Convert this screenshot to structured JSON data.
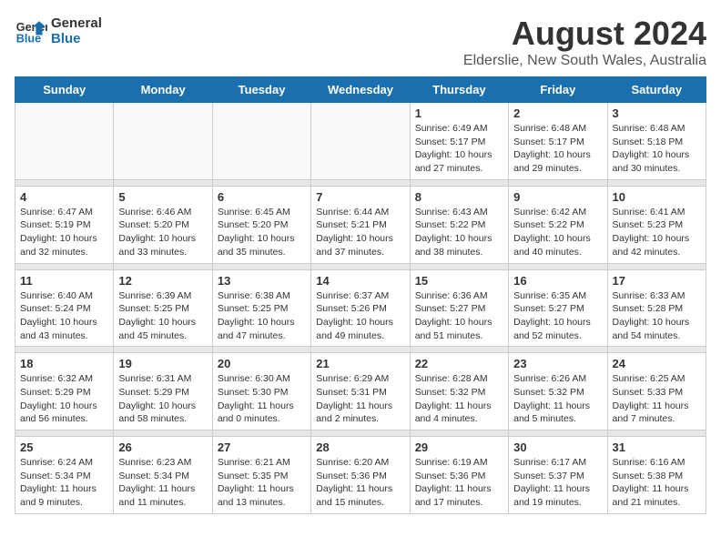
{
  "header": {
    "logo_line1": "General",
    "logo_line2": "Blue",
    "month": "August 2024",
    "location": "Elderslie, New South Wales, Australia"
  },
  "weekdays": [
    "Sunday",
    "Monday",
    "Tuesday",
    "Wednesday",
    "Thursday",
    "Friday",
    "Saturday"
  ],
  "weeks": [
    [
      {
        "day": "",
        "info": ""
      },
      {
        "day": "",
        "info": ""
      },
      {
        "day": "",
        "info": ""
      },
      {
        "day": "",
        "info": ""
      },
      {
        "day": "1",
        "info": "Sunrise: 6:49 AM\nSunset: 5:17 PM\nDaylight: 10 hours and 27 minutes."
      },
      {
        "day": "2",
        "info": "Sunrise: 6:48 AM\nSunset: 5:17 PM\nDaylight: 10 hours and 29 minutes."
      },
      {
        "day": "3",
        "info": "Sunrise: 6:48 AM\nSunset: 5:18 PM\nDaylight: 10 hours and 30 minutes."
      }
    ],
    [
      {
        "day": "4",
        "info": "Sunrise: 6:47 AM\nSunset: 5:19 PM\nDaylight: 10 hours and 32 minutes."
      },
      {
        "day": "5",
        "info": "Sunrise: 6:46 AM\nSunset: 5:20 PM\nDaylight: 10 hours and 33 minutes."
      },
      {
        "day": "6",
        "info": "Sunrise: 6:45 AM\nSunset: 5:20 PM\nDaylight: 10 hours and 35 minutes."
      },
      {
        "day": "7",
        "info": "Sunrise: 6:44 AM\nSunset: 5:21 PM\nDaylight: 10 hours and 37 minutes."
      },
      {
        "day": "8",
        "info": "Sunrise: 6:43 AM\nSunset: 5:22 PM\nDaylight: 10 hours and 38 minutes."
      },
      {
        "day": "9",
        "info": "Sunrise: 6:42 AM\nSunset: 5:22 PM\nDaylight: 10 hours and 40 minutes."
      },
      {
        "day": "10",
        "info": "Sunrise: 6:41 AM\nSunset: 5:23 PM\nDaylight: 10 hours and 42 minutes."
      }
    ],
    [
      {
        "day": "11",
        "info": "Sunrise: 6:40 AM\nSunset: 5:24 PM\nDaylight: 10 hours and 43 minutes."
      },
      {
        "day": "12",
        "info": "Sunrise: 6:39 AM\nSunset: 5:25 PM\nDaylight: 10 hours and 45 minutes."
      },
      {
        "day": "13",
        "info": "Sunrise: 6:38 AM\nSunset: 5:25 PM\nDaylight: 10 hours and 47 minutes."
      },
      {
        "day": "14",
        "info": "Sunrise: 6:37 AM\nSunset: 5:26 PM\nDaylight: 10 hours and 49 minutes."
      },
      {
        "day": "15",
        "info": "Sunrise: 6:36 AM\nSunset: 5:27 PM\nDaylight: 10 hours and 51 minutes."
      },
      {
        "day": "16",
        "info": "Sunrise: 6:35 AM\nSunset: 5:27 PM\nDaylight: 10 hours and 52 minutes."
      },
      {
        "day": "17",
        "info": "Sunrise: 6:33 AM\nSunset: 5:28 PM\nDaylight: 10 hours and 54 minutes."
      }
    ],
    [
      {
        "day": "18",
        "info": "Sunrise: 6:32 AM\nSunset: 5:29 PM\nDaylight: 10 hours and 56 minutes."
      },
      {
        "day": "19",
        "info": "Sunrise: 6:31 AM\nSunset: 5:29 PM\nDaylight: 10 hours and 58 minutes."
      },
      {
        "day": "20",
        "info": "Sunrise: 6:30 AM\nSunset: 5:30 PM\nDaylight: 11 hours and 0 minutes."
      },
      {
        "day": "21",
        "info": "Sunrise: 6:29 AM\nSunset: 5:31 PM\nDaylight: 11 hours and 2 minutes."
      },
      {
        "day": "22",
        "info": "Sunrise: 6:28 AM\nSunset: 5:32 PM\nDaylight: 11 hours and 4 minutes."
      },
      {
        "day": "23",
        "info": "Sunrise: 6:26 AM\nSunset: 5:32 PM\nDaylight: 11 hours and 5 minutes."
      },
      {
        "day": "24",
        "info": "Sunrise: 6:25 AM\nSunset: 5:33 PM\nDaylight: 11 hours and 7 minutes."
      }
    ],
    [
      {
        "day": "25",
        "info": "Sunrise: 6:24 AM\nSunset: 5:34 PM\nDaylight: 11 hours and 9 minutes."
      },
      {
        "day": "26",
        "info": "Sunrise: 6:23 AM\nSunset: 5:34 PM\nDaylight: 11 hours and 11 minutes."
      },
      {
        "day": "27",
        "info": "Sunrise: 6:21 AM\nSunset: 5:35 PM\nDaylight: 11 hours and 13 minutes."
      },
      {
        "day": "28",
        "info": "Sunrise: 6:20 AM\nSunset: 5:36 PM\nDaylight: 11 hours and 15 minutes."
      },
      {
        "day": "29",
        "info": "Sunrise: 6:19 AM\nSunset: 5:36 PM\nDaylight: 11 hours and 17 minutes."
      },
      {
        "day": "30",
        "info": "Sunrise: 6:17 AM\nSunset: 5:37 PM\nDaylight: 11 hours and 19 minutes."
      },
      {
        "day": "31",
        "info": "Sunrise: 6:16 AM\nSunset: 5:38 PM\nDaylight: 11 hours and 21 minutes."
      }
    ]
  ]
}
